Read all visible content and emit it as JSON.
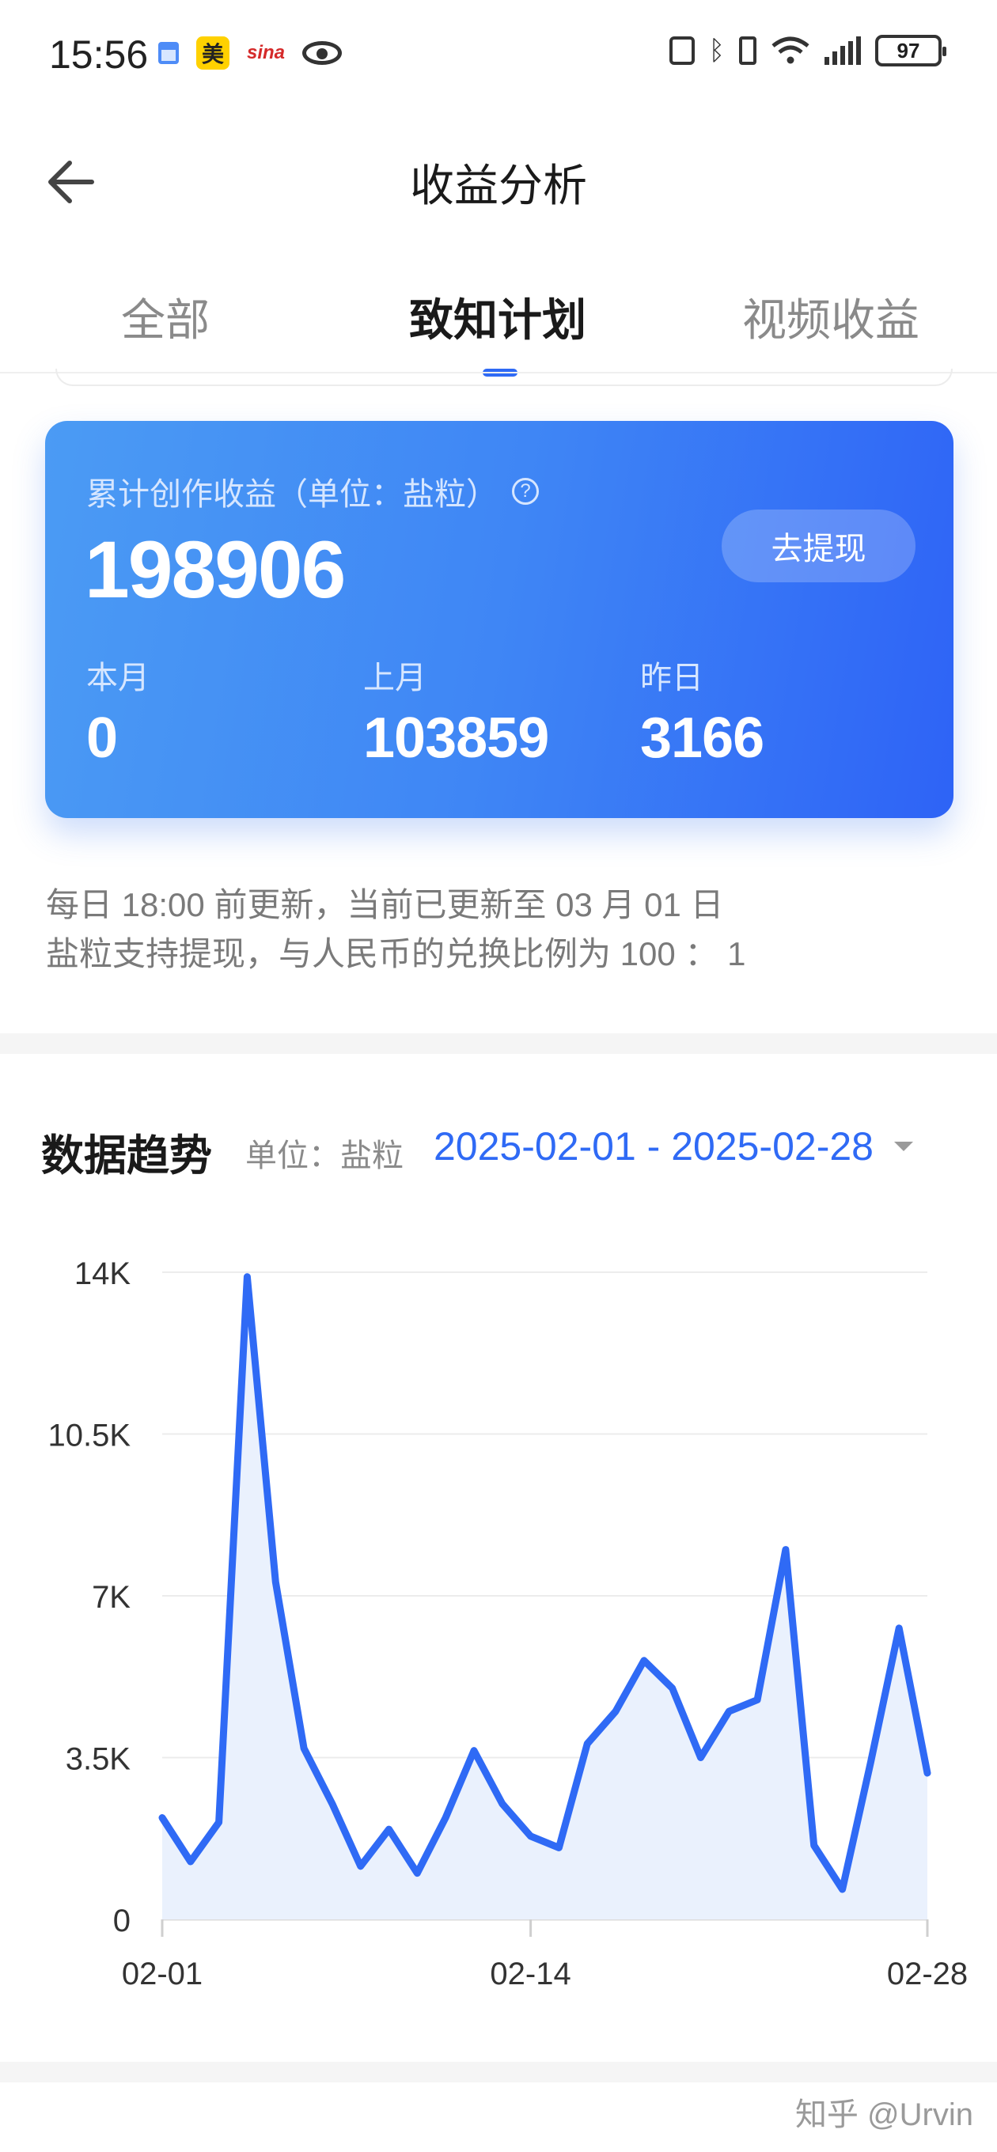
{
  "status_bar": {
    "time": "15:56",
    "left_icons": [
      "calendar-icon",
      "meituan-icon",
      "sina-icon",
      "eye-icon"
    ],
    "meituan_label": "美",
    "sina_label": "sina",
    "right_icons": [
      "nfc-icon",
      "bluetooth-icon",
      "vibrate-icon",
      "wifi-icon",
      "signal-icon"
    ],
    "battery": "97"
  },
  "header": {
    "title": "收益分析",
    "back_icon": "arrow-left-icon"
  },
  "tabs": [
    {
      "label": "全部",
      "active": false
    },
    {
      "label": "致知计划",
      "active": true
    },
    {
      "label": "视频收益",
      "active": false
    }
  ],
  "earnings": {
    "label": "累计创作收益（单位：盐粒）",
    "help_icon": "question-circle-icon",
    "help_glyph": "?",
    "total": "198906",
    "withdraw_label": "去提现",
    "stats": [
      {
        "label": "本月",
        "value": "0"
      },
      {
        "label": "上月",
        "value": "103859"
      },
      {
        "label": "昨日",
        "value": "3166"
      }
    ]
  },
  "notes": [
    "每日 18:00 前更新，当前已更新至 03 月 01 日",
    "盐粒支持提现，与人民币的兑换比例为 100 ： 1"
  ],
  "trend": {
    "title": "数据趋势",
    "unit": "单位：盐粒",
    "date_range": "2025-02-01 - 2025-02-28",
    "dropdown_icon": "caret-down-icon"
  },
  "chart_data": {
    "type": "area",
    "title": "",
    "xlabel": "",
    "ylabel": "",
    "x": [
      "02-01",
      "02-02",
      "02-03",
      "02-04",
      "02-05",
      "02-06",
      "02-07",
      "02-08",
      "02-09",
      "02-10",
      "02-11",
      "02-12",
      "02-13",
      "02-14",
      "02-15",
      "02-16",
      "02-17",
      "02-18",
      "02-19",
      "02-20",
      "02-21",
      "02-22",
      "02-23",
      "02-24",
      "02-25",
      "02-26",
      "02-27",
      "02-28"
    ],
    "x_tick_labels": [
      "02-01",
      "02-14",
      "02-28"
    ],
    "y_tick_labels": [
      "0",
      "3.5K",
      "7K",
      "10.5K",
      "14K"
    ],
    "y_ticks": [
      0,
      3500,
      7000,
      10500,
      14000
    ],
    "ylim": [
      0,
      14000
    ],
    "grid": true,
    "line_color": "#2f6af5",
    "fill_color": "#eaf1fd",
    "series": [
      {
        "values": [
          2200,
          1250,
          2100,
          13900,
          7300,
          3700,
          2500,
          1150,
          1950,
          1000,
          2200,
          3650,
          2500,
          1800,
          1550,
          3800,
          4500,
          5600,
          5000,
          3500,
          4500,
          4750,
          8000,
          1600,
          650,
          3400,
          6300,
          3166
        ]
      }
    ]
  },
  "watermark": "知乎 @Urvin"
}
